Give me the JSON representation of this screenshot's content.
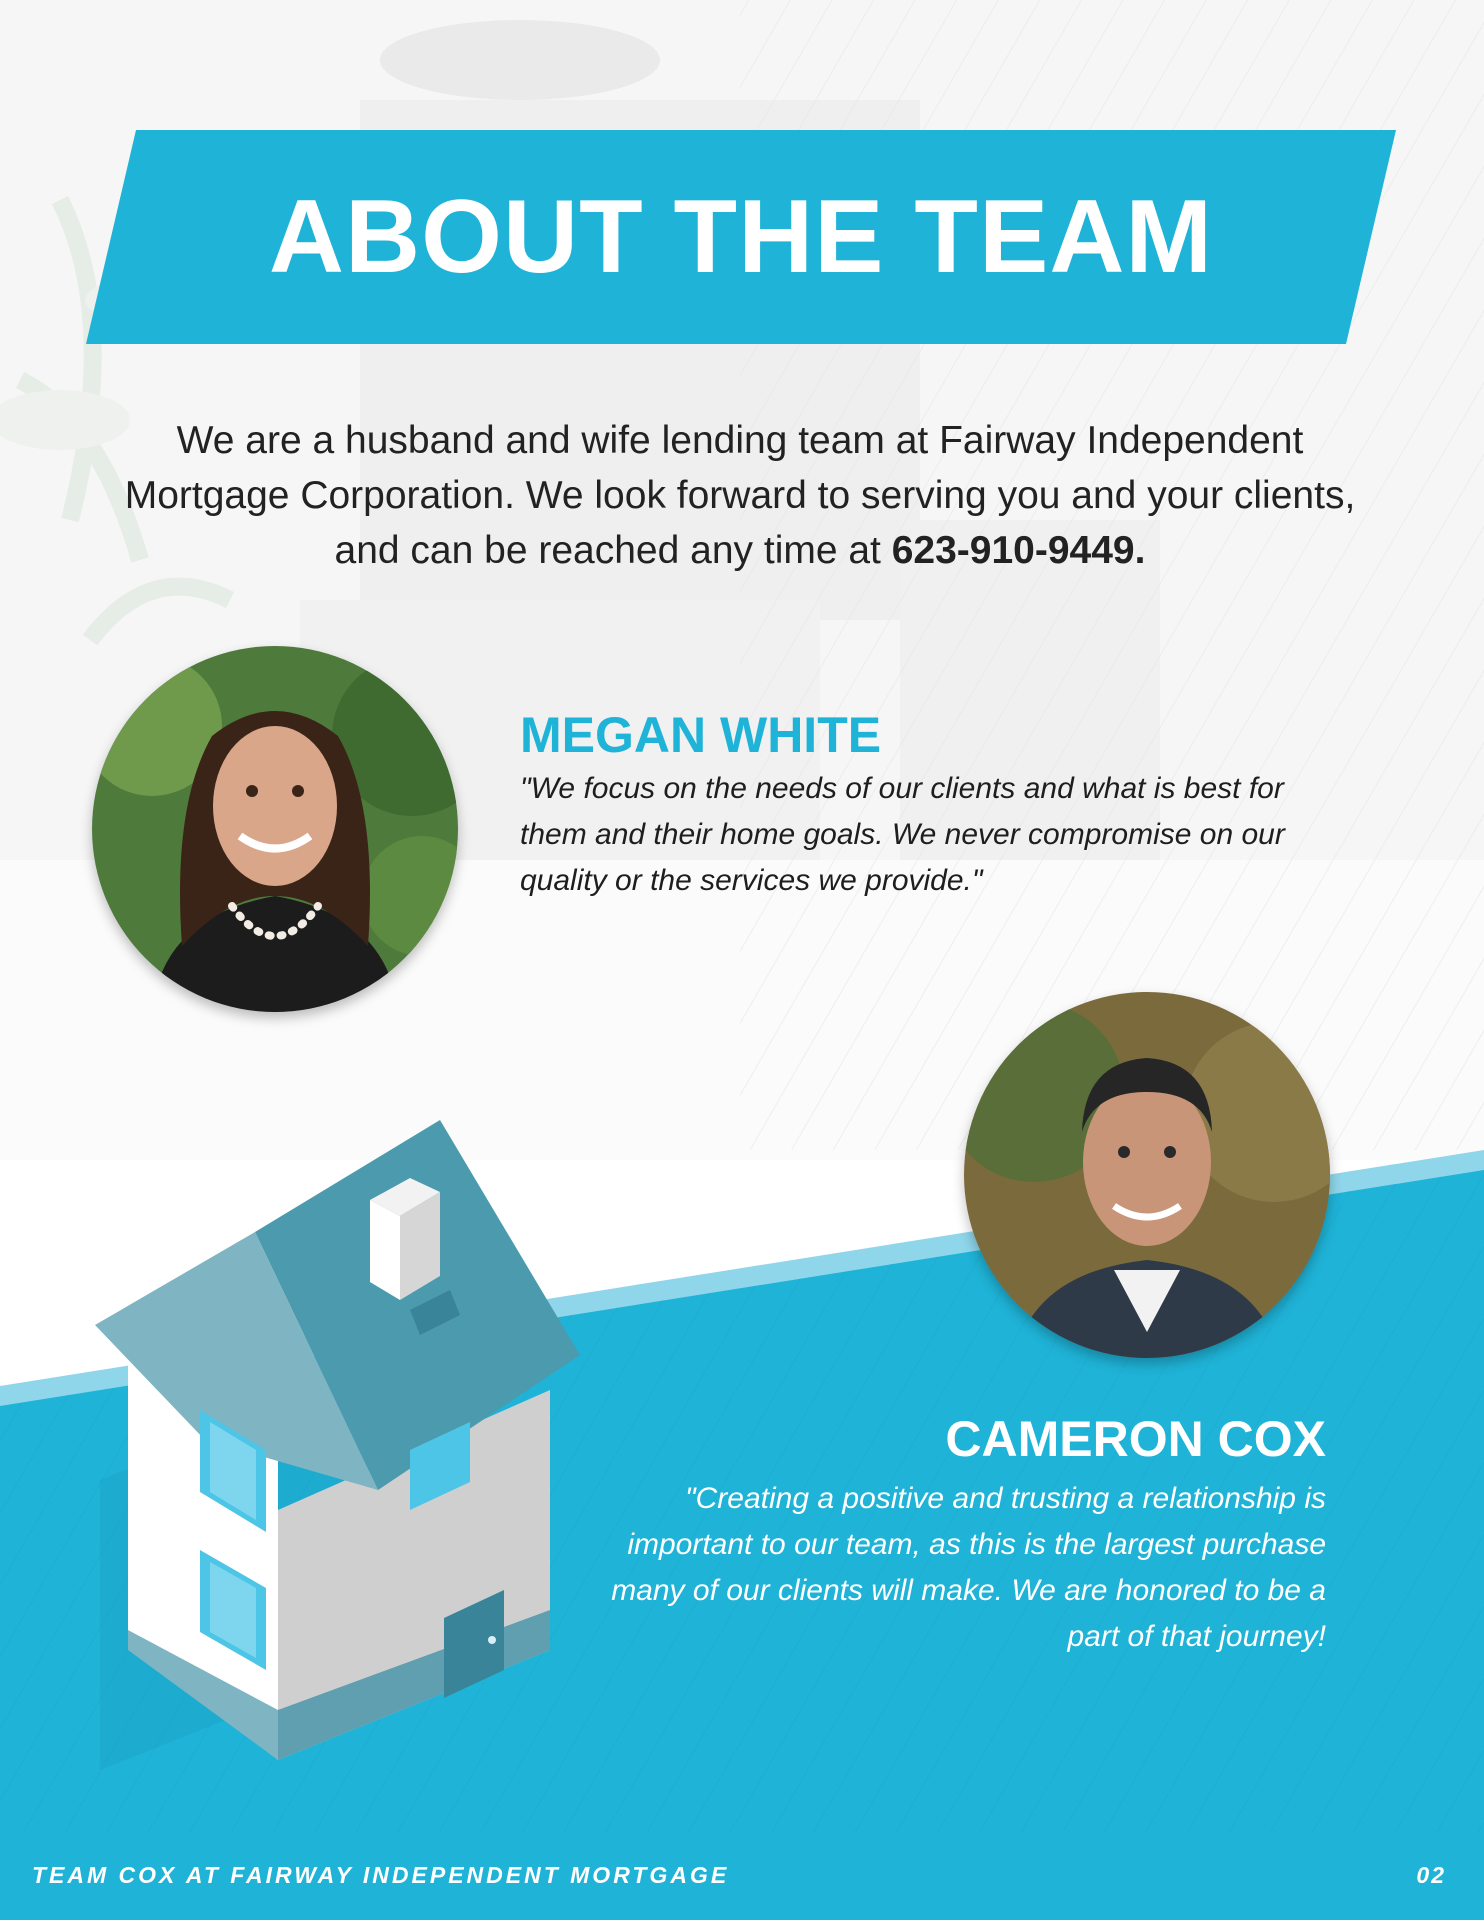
{
  "banner": {
    "title": "ABOUT THE TEAM"
  },
  "intro": {
    "text": "We are a husband and wife lending team at Fairway Independent Mortgage Corporation. We look forward to serving you and your clients, and can be reached any time at ",
    "phone": "623-910-9449."
  },
  "team": [
    {
      "name": "MEGAN WHITE",
      "quote": "\"We focus on the needs of our clients and what is best for them and their home goals. We never compromise on our quality or the services we provide.\""
    },
    {
      "name": "CAMERON COX",
      "quote": "\"Creating a positive and trusting a relationship is important to our team, as this is the largest purchase many of our clients will make. We are honored to be a part of that journey!"
    }
  ],
  "footer": {
    "left": "TEAM COX AT FAIRWAY INDEPENDENT MORTGAGE",
    "page_number": "02"
  },
  "colors": {
    "accent": "#1fb3d7",
    "accent_dark": "#1a9ec0",
    "roof": "#4c9aad",
    "text": "#222222"
  }
}
